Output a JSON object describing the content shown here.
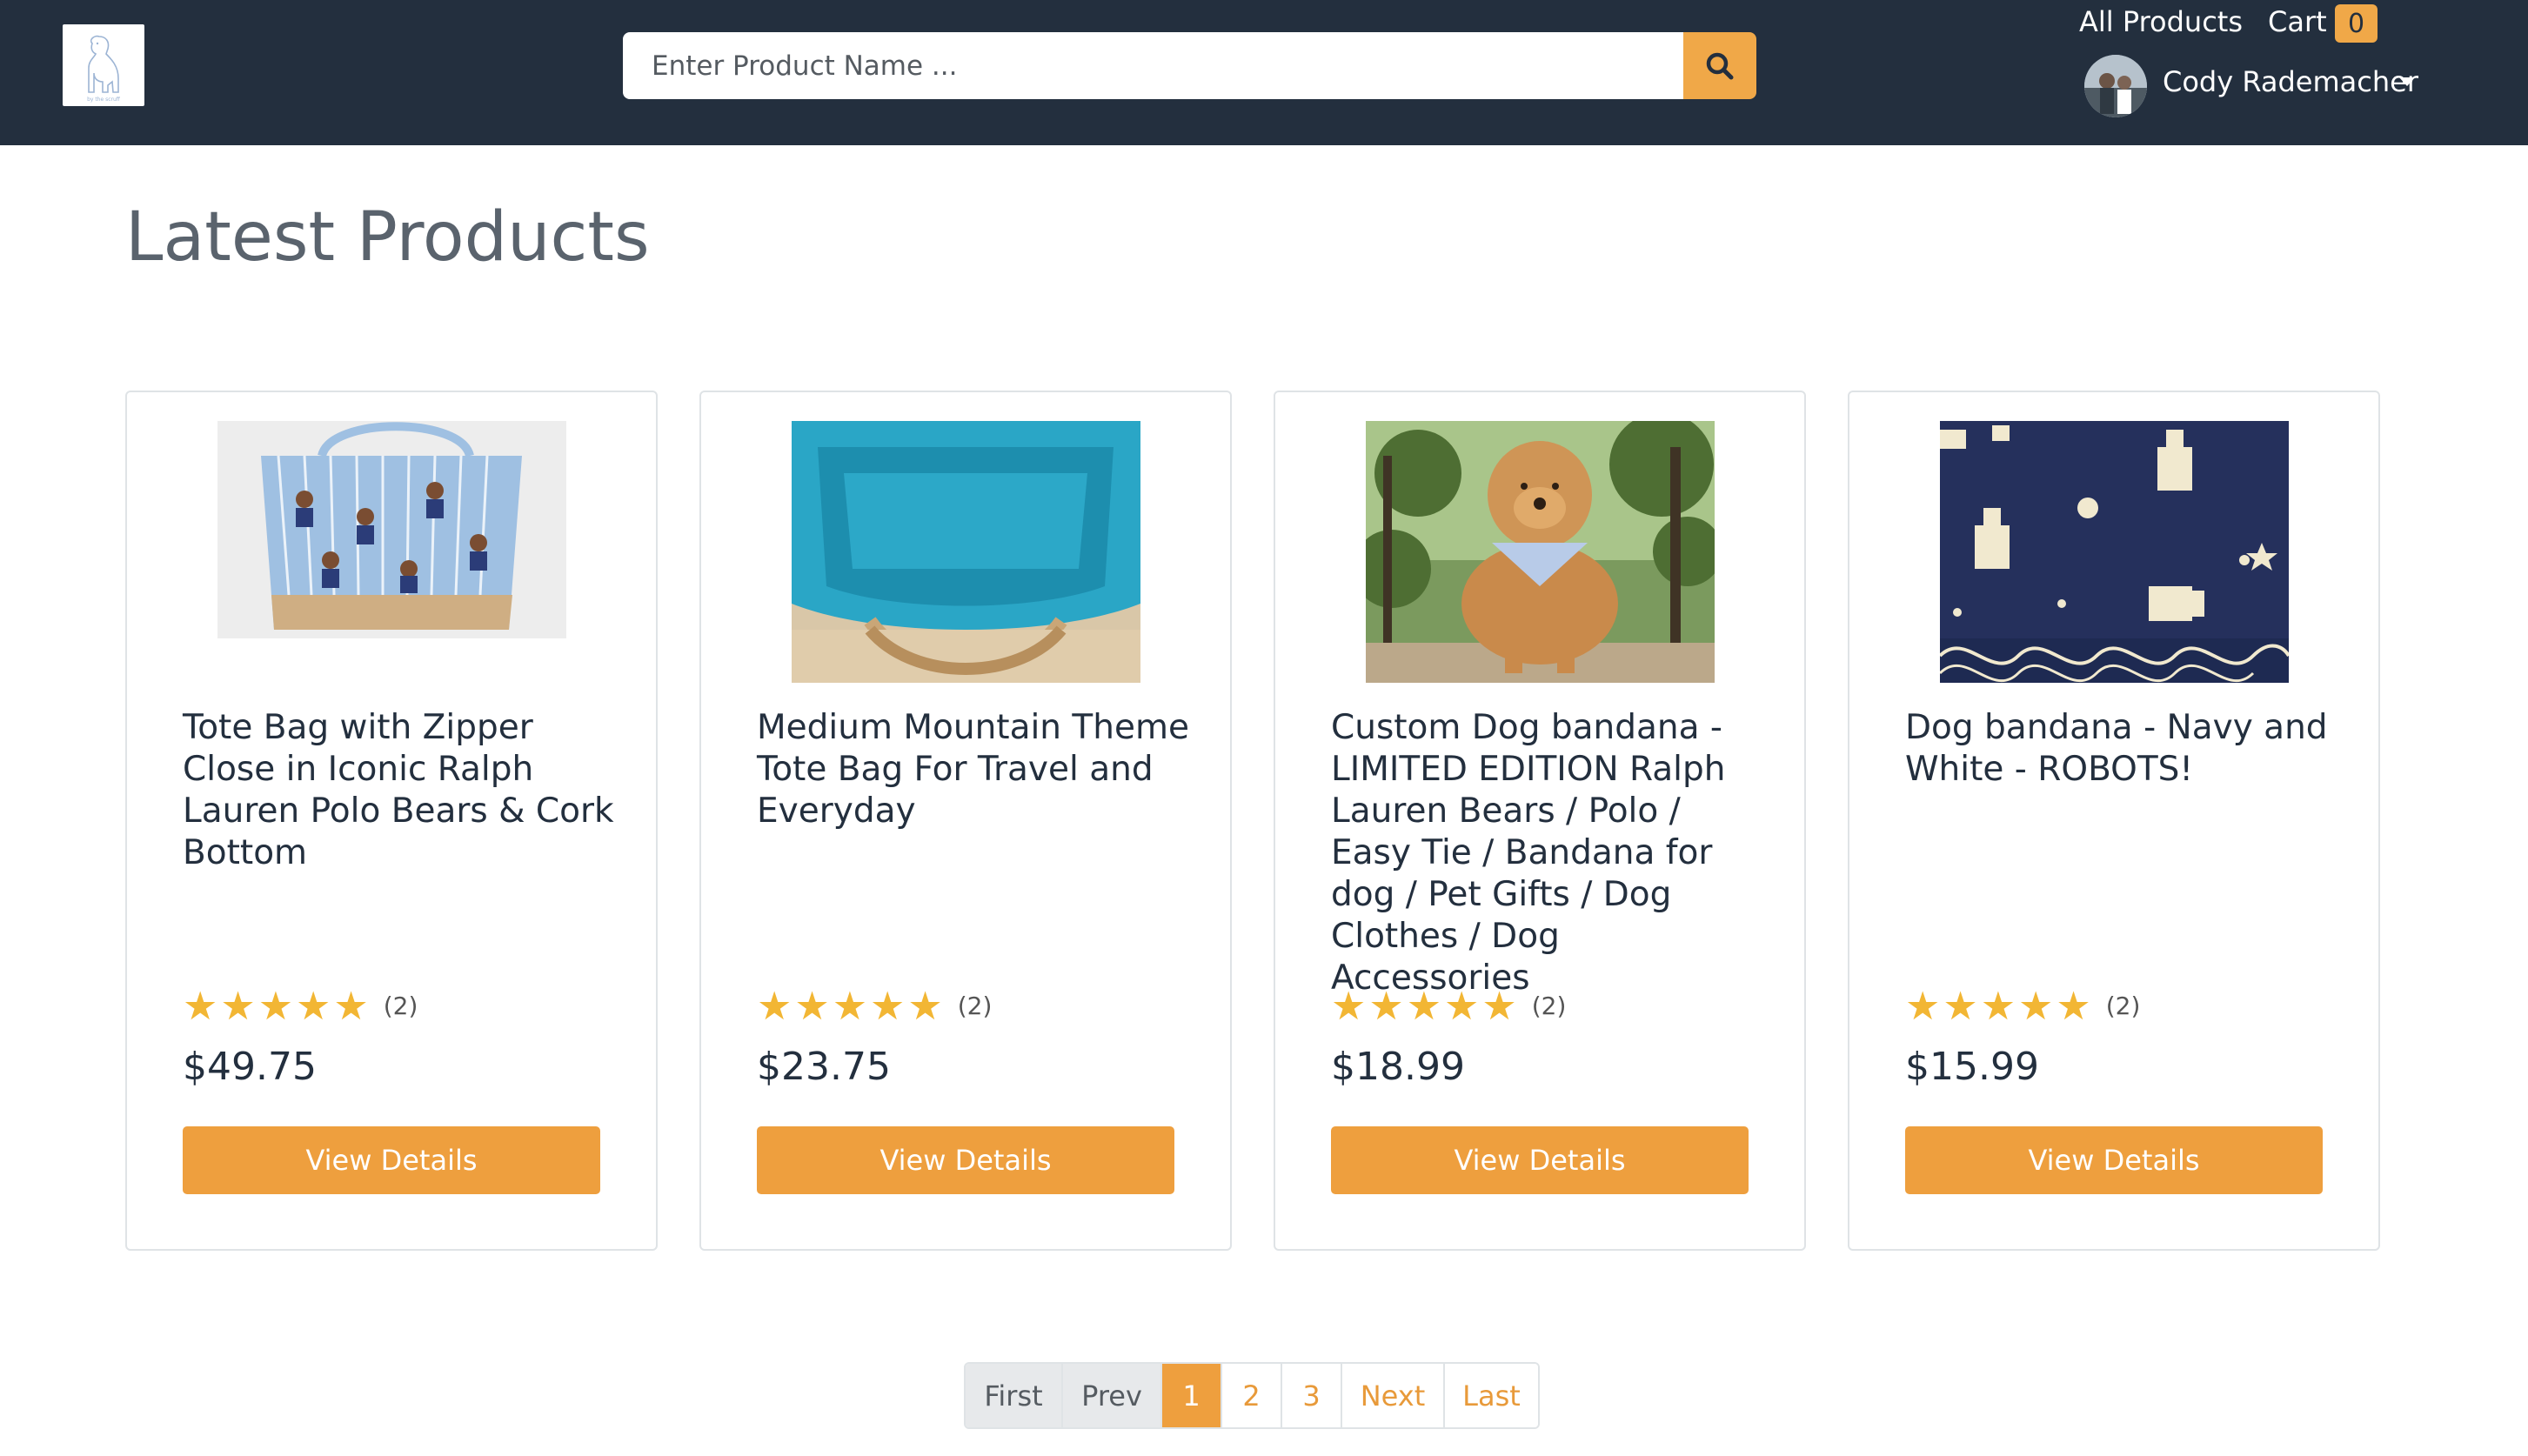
{
  "header": {
    "logo_alt": "by the scruff",
    "search_placeholder": "Enter Product Name ...",
    "nav_all_products": "All Products",
    "nav_cart": "Cart",
    "cart_count": "0",
    "user_name": "Cody Rademacher"
  },
  "page_title": "Latest Products",
  "products": [
    {
      "title": "Tote Bag with Zipper Close in Iconic Ralph Lauren Polo Bears & Cork Bottom",
      "rating": 5,
      "reviews": "(2)",
      "price": "$49.75",
      "button": "View Details"
    },
    {
      "title": "Medium Mountain Theme Tote Bag For Travel and Everyday",
      "rating": 5,
      "reviews": "(2)",
      "price": "$23.75",
      "button": "View Details"
    },
    {
      "title": "Custom Dog bandana - LIMITED EDITION Ralph Lauren Bears / Polo / Easy Tie / Bandana for dog / Pet Gifts / Dog Clothes / Dog Accessories",
      "rating": 5,
      "reviews": "(2)",
      "price": "$18.99",
      "button": "View Details"
    },
    {
      "title": "Dog bandana - Navy and White - ROBOTS!",
      "rating": 5,
      "reviews": "(2)",
      "price": "$15.99",
      "button": "View Details"
    }
  ],
  "pagination": {
    "first": "First",
    "prev": "Prev",
    "pages": [
      "1",
      "2",
      "3"
    ],
    "active_page": "1",
    "next": "Next",
    "last": "Last"
  },
  "colors": {
    "navbar": "#232f3e",
    "accent": "#ee9f3e",
    "star": "#f2b634"
  }
}
